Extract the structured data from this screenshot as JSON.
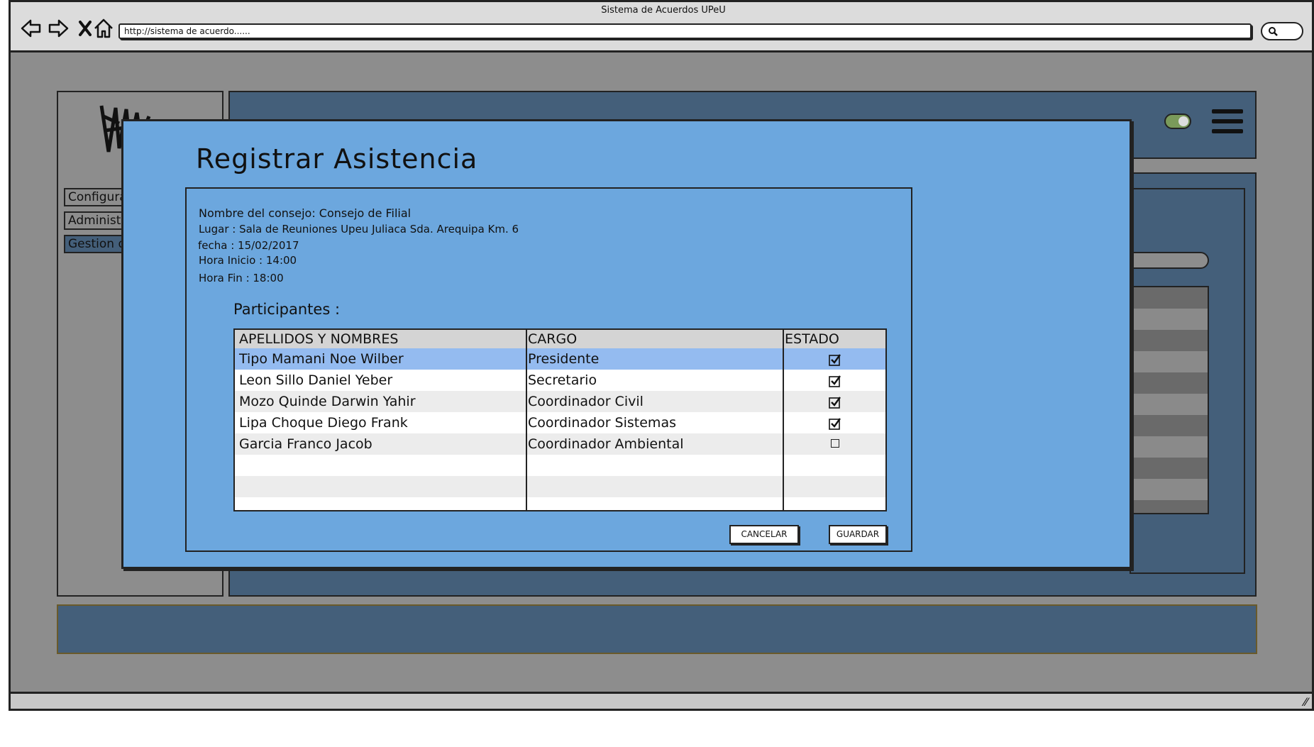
{
  "window": {
    "title": "Sistema de Acuerdos UPeU"
  },
  "browser": {
    "url": "http://sistema de acuerdo......"
  },
  "sidebar": {
    "items": [
      {
        "label": "Configuración"
      },
      {
        "label": "Administración"
      },
      {
        "label": "Gestion de Acuerdos"
      }
    ]
  },
  "modal": {
    "title": "Registrar Asistencia",
    "info": {
      "consejo": "Nombre del consejo:  Consejo de Filial",
      "lugar": "Lugar : Sala de Reuniones Upeu Juliaca Sda. Arequipa Km. 6",
      "fecha": "fecha : 15/02/2017",
      "hora_inicio": "Hora Inicio : 14:00",
      "hora_fin": "Hora Fin : 18:00"
    },
    "participants_label": "Participantes :",
    "table": {
      "headers": [
        "APELLIDOS Y NOMBRES",
        "CARGO",
        "ESTADO"
      ],
      "rows": [
        {
          "name": "Tipo Mamani Noe Wilber",
          "cargo": " Presidente",
          "present": true
        },
        {
          "name": "Leon Sillo Daniel Yeber",
          "cargo": "Secretario",
          "present": true
        },
        {
          "name": "Mozo Quinde Darwin Yahir",
          "cargo": "Coordinador Civil",
          "present": true
        },
        {
          "name": "Lipa Choque Diego Frank",
          "cargo": "Coordinador Sistemas",
          "present": true
        },
        {
          "name": "Garcia Franco Jacob",
          "cargo": "Coordinador Ambiental",
          "present": false
        }
      ]
    },
    "buttons": {
      "cancel": "CANCELAR",
      "save": "GUARDAR"
    }
  },
  "colors": {
    "modal_bg": "#6ca7de",
    "selected_row": "#94bbf0",
    "app_dark": "#445f7a"
  }
}
